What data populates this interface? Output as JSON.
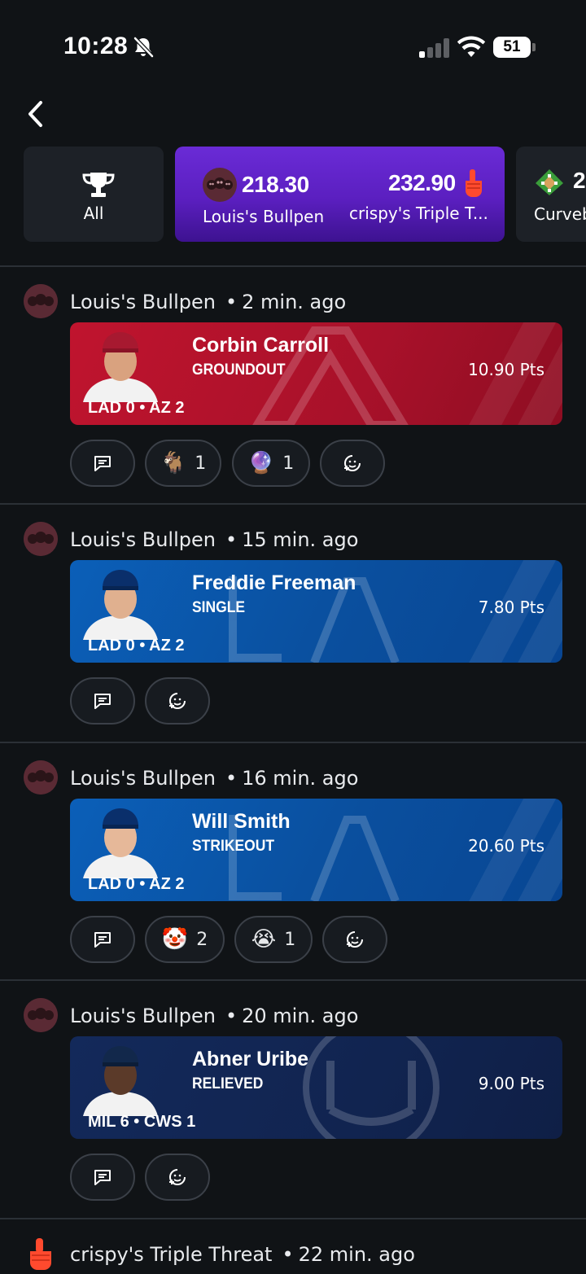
{
  "status_bar": {
    "time": "10:28",
    "battery": "51"
  },
  "carousel": {
    "all_label": "All",
    "matchup": {
      "left_score": "218.30",
      "left_team": "Louis's Bullpen",
      "right_score": "232.90",
      "right_team": "crispy's Triple T..."
    },
    "next": {
      "score": "2",
      "team": "Curveb"
    }
  },
  "feed": [
    {
      "owner": "Louis's Bullpen",
      "time": "2 min. ago",
      "player": "Corbin Carroll",
      "result": "GROUNDOUT",
      "points": "10.90 Pts",
      "game": "LAD 0 • AZ 2",
      "reactions": [
        {
          "emoji": "🐐",
          "count": "1"
        },
        {
          "emoji": "🔮",
          "count": "1"
        }
      ]
    },
    {
      "owner": "Louis's Bullpen",
      "time": "15 min. ago",
      "player": "Freddie Freeman",
      "result": "SINGLE",
      "points": "7.80 Pts",
      "game": "LAD 0 • AZ 2",
      "reactions": []
    },
    {
      "owner": "Louis's Bullpen",
      "time": "16 min. ago",
      "player": "Will Smith",
      "result": "STRIKEOUT",
      "points": "20.60 Pts",
      "game": "LAD 0 • AZ 2",
      "reactions": [
        {
          "emoji": "🤡",
          "count": "2"
        },
        {
          "emoji": "😭",
          "count": "1"
        }
      ]
    },
    {
      "owner": "Louis's Bullpen",
      "time": "20 min. ago",
      "player": "Abner Uribe",
      "result": "RELIEVED",
      "points": "9.00 Pts",
      "game": "MIL 6 • CWS 1",
      "reactions": []
    },
    {
      "owner": "crispy's Triple Threat",
      "time": "22 min. ago"
    }
  ],
  "colors": {
    "background": "#101316",
    "arizona_red": "#c0142e",
    "dodgers_blue": "#0b5fb8",
    "brewers_navy": "#13295a",
    "matchup_purple": "#6a2bd6"
  },
  "icons": [
    "bell-slash-icon",
    "signal-icon",
    "wifi-icon",
    "battery-icon",
    "back-chevron-icon",
    "trophy-icon",
    "skulls-avatar-icon",
    "foam-finger-icon",
    "baseball-diamond-icon",
    "comment-icon",
    "add-reaction-icon"
  ]
}
